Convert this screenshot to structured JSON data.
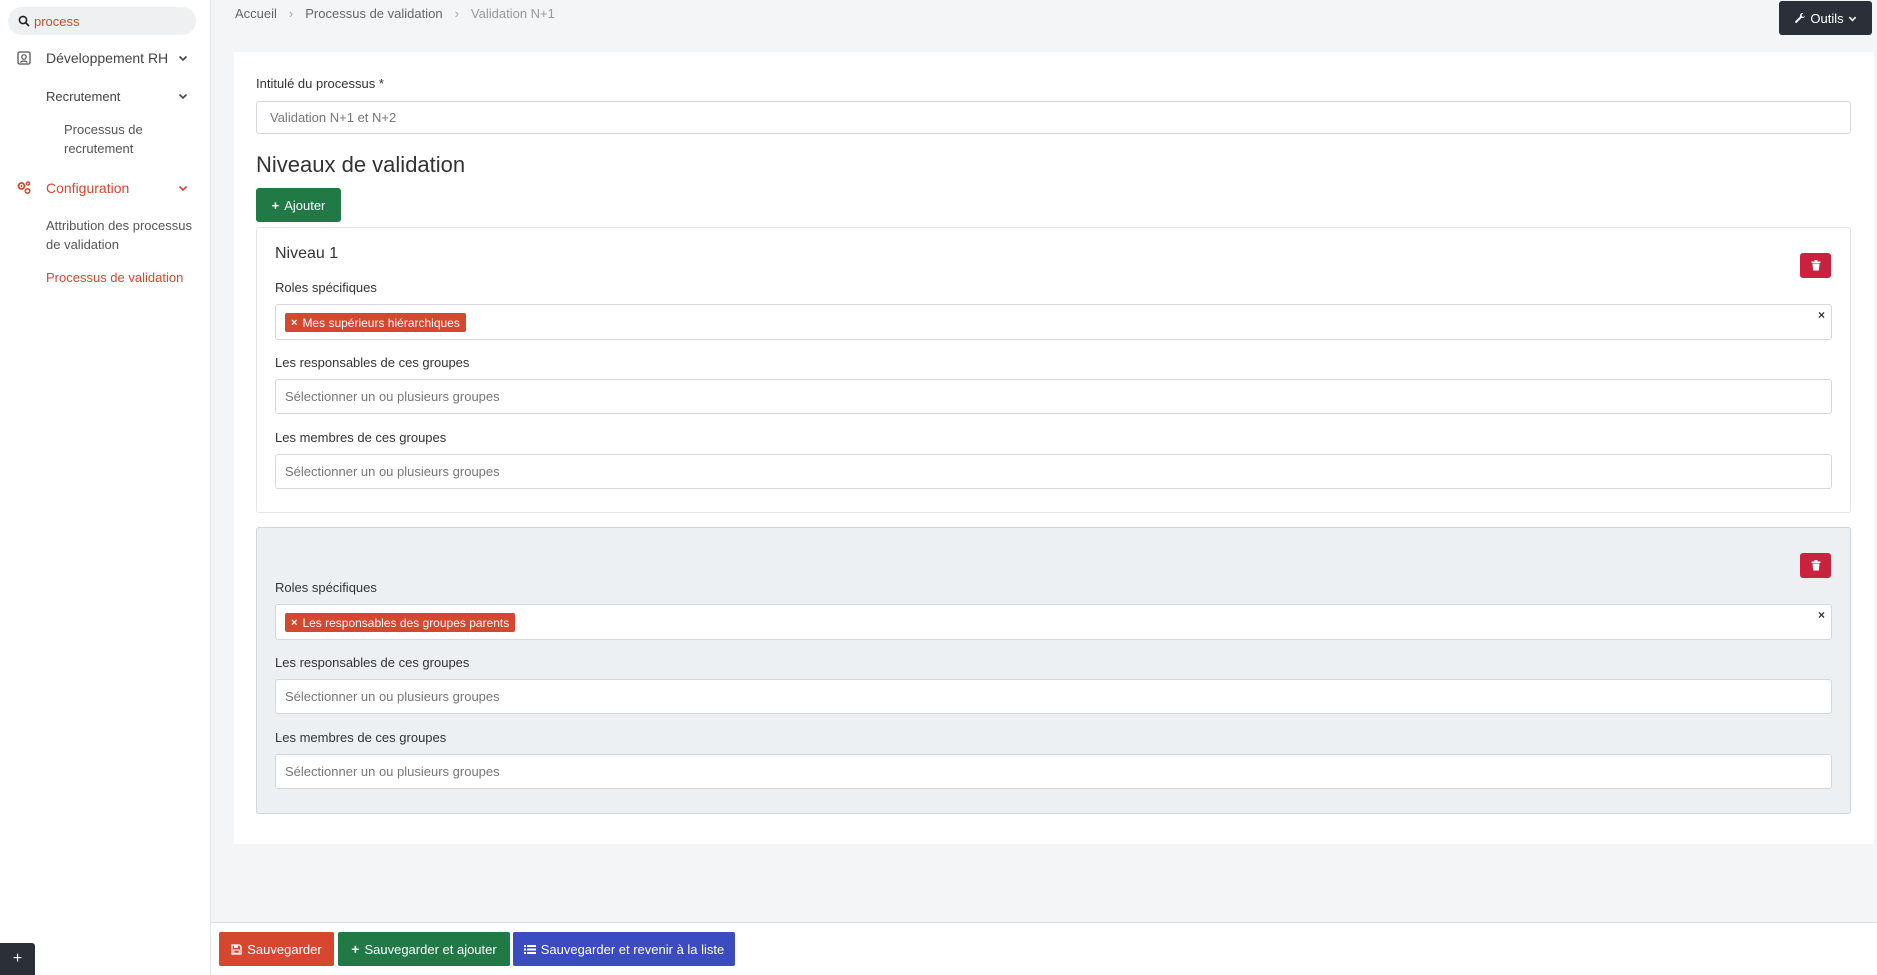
{
  "sidebar": {
    "search_value": "process",
    "search_icon": "search-icon",
    "items": [
      {
        "label": "Développement RH",
        "icon": "people-icon"
      },
      {
        "label": "Recrutement"
      },
      {
        "label": "Processus de recrutement"
      },
      {
        "label": "Configuration",
        "icon": "gears-icon"
      },
      {
        "label": "Attribution des processus de validation"
      },
      {
        "label": "Processus de validation"
      }
    ],
    "bottom_plus": "+"
  },
  "breadcrumb": [
    "Accueil",
    "Processus de validation",
    "Validation N+1"
  ],
  "tools_label": "Outils",
  "form": {
    "title_label": "Intitulé du processus *",
    "title_value": "Validation N+1 et N+2",
    "section_title": "Niveaux de validation",
    "add_label": "Ajouter",
    "levels": [
      {
        "title": "Niveau 1",
        "roles_label": "Roles spécifiques",
        "roles_tag": "Mes supérieurs hiérarchiques",
        "managers_label": "Les responsables de ces groupes",
        "managers_placeholder": "Sélectionner un ou plusieurs groupes",
        "members_label": "Les membres de ces groupes",
        "members_placeholder": "Sélectionner un ou plusieurs groupes"
      },
      {
        "title": "",
        "roles_label": "Roles spécifiques",
        "roles_tag": "Les responsables des groupes parents",
        "managers_label": "Les responsables de ces groupes",
        "managers_placeholder": "Sélectionner un ou plusieurs groupes",
        "members_label": "Les membres de ces groupes",
        "members_placeholder": "Sélectionner un ou plusieurs groupes"
      }
    ]
  },
  "footer": {
    "save": "Sauvegarder",
    "save_add": "Sauvegarder et ajouter",
    "save_back": "Sauvegarder et revenir à la liste"
  },
  "colors": {
    "accent_red": "#d6472f",
    "green": "#217a46",
    "blue": "#3b4bc0",
    "danger": "#c8223f",
    "dark": "#2b3038"
  }
}
